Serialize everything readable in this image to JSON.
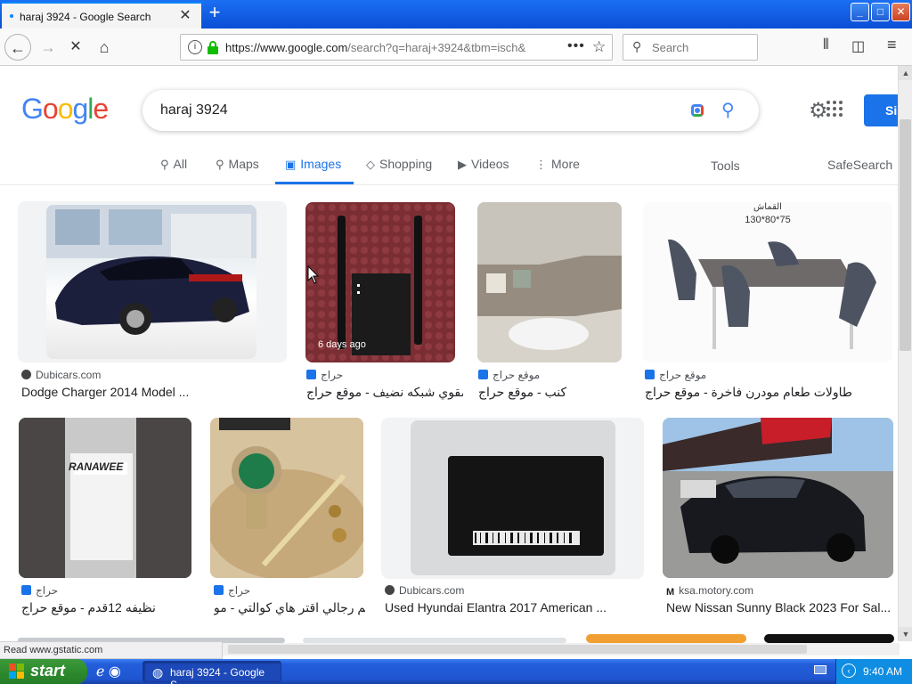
{
  "browser": {
    "tab_title": "haraj 3924 - Google Search",
    "new_tab": "+",
    "url_main": "https://www.google.com",
    "url_rest": "/search?q=haraj+3924&tbm=isch&",
    "search_placeholder": "Search",
    "status": "Read www.gstatic.com",
    "window_buttons": {
      "minimize": "_",
      "maximize": "□",
      "close": "✕"
    }
  },
  "google": {
    "logo": {
      "g1": "G",
      "o1": "o",
      "o2": "o",
      "g2": "g",
      "l": "l",
      "e": "e"
    },
    "query": "haraj 3924",
    "signin": "Si",
    "tabs": [
      {
        "label": "All",
        "icon": "search-icon"
      },
      {
        "label": "Maps",
        "icon": "pin-icon"
      },
      {
        "label": "Images",
        "icon": "image-icon",
        "active": true
      },
      {
        "label": "Shopping",
        "icon": "tag-icon"
      },
      {
        "label": "Videos",
        "icon": "play-icon"
      },
      {
        "label": "More",
        "icon": "more-vert-icon"
      }
    ],
    "tools": "Tools",
    "safesearch": "SafeSearch"
  },
  "results": [
    {
      "source": "Dubicars.com",
      "favicon": "dubicars",
      "title": "Dodge Charger 2014 Model ..."
    },
    {
      "source": "حراج",
      "favicon": "haraj",
      "title": "مقوي شبكه نضيف - موقع حراج",
      "badge": "6 days ago"
    },
    {
      "source": "موقع حراج",
      "favicon": "haraj",
      "title": "كنب - موقع حراج"
    },
    {
      "source": "موقع حراج",
      "favicon": "haraj",
      "title": "طاولات طعام مودرن فاخرة - موقع حراج",
      "image_caption": "130*80*75",
      "image_header": "القماش"
    },
    {
      "source": "حراج",
      "favicon": "haraj",
      "title": "نظيفه 12قدم - موقع حراج",
      "image_text": "RANAWEE"
    },
    {
      "source": "حراج",
      "favicon": "haraj",
      "title": "اطقم رجالي اقتر هاي كوالتي - مو..."
    },
    {
      "source": "Dubicars.com",
      "favicon": "dubicars",
      "title": "Used Hyundai Elantra 2017 American ..."
    },
    {
      "source": "ksa.motory.com",
      "favicon": "motory",
      "title": "New Nissan Sunny Black 2023 For Sal..."
    }
  ],
  "taskbar": {
    "start": "start",
    "task_label": "haraj 3924 - Google S...",
    "clock": "9:40 AM"
  },
  "colors": {
    "google_blue": "#1a73e8",
    "titlebar_blue": "#0a4fd6",
    "taskbar_blue": "#245edb",
    "start_green": "#2e8b2e"
  }
}
